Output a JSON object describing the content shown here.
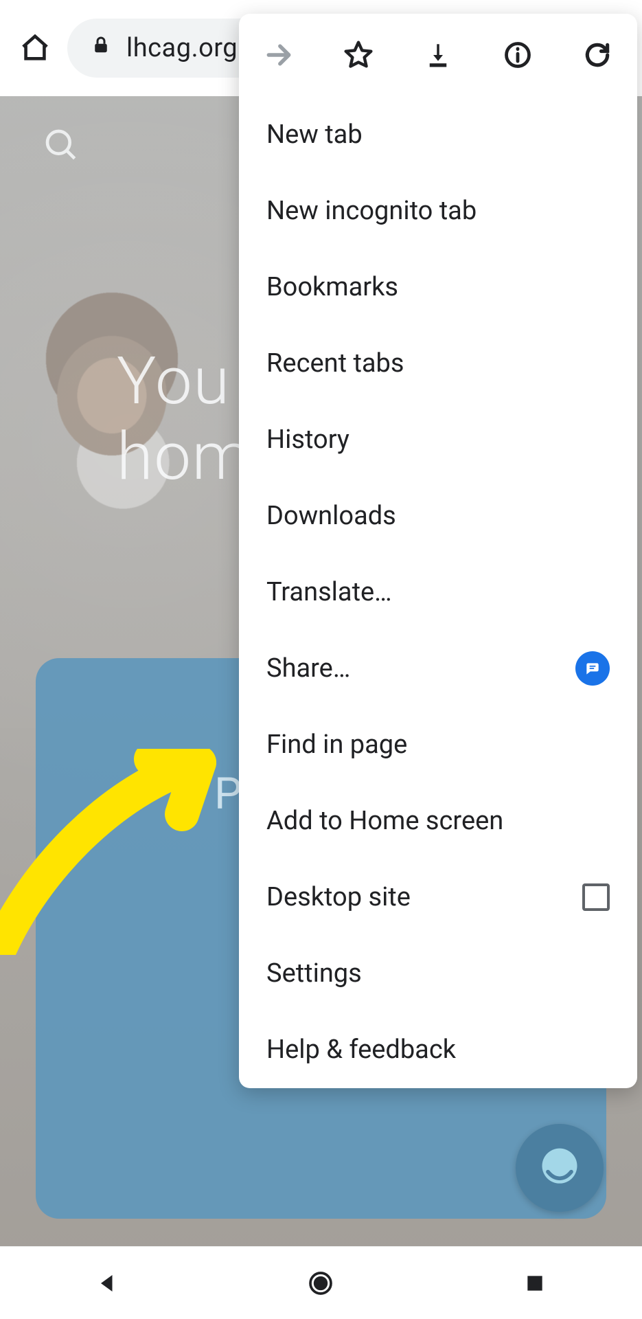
{
  "browser": {
    "url_display": "lhcag.org"
  },
  "page": {
    "hero_line1": "You",
    "hero_line2": "hom",
    "card_letter": "P"
  },
  "menu": {
    "items": [
      {
        "label": "New tab"
      },
      {
        "label": "New incognito tab"
      },
      {
        "label": "Bookmarks"
      },
      {
        "label": "Recent tabs"
      },
      {
        "label": "History"
      },
      {
        "label": "Downloads"
      },
      {
        "label": "Translate…"
      },
      {
        "label": "Share…"
      },
      {
        "label": "Find in page"
      },
      {
        "label": "Add to Home screen"
      },
      {
        "label": "Desktop site"
      },
      {
        "label": "Settings"
      },
      {
        "label": "Help & feedback"
      }
    ]
  },
  "annotation": {
    "target_menu_item": "Add to Home screen",
    "arrow_color": "#ffe400"
  }
}
